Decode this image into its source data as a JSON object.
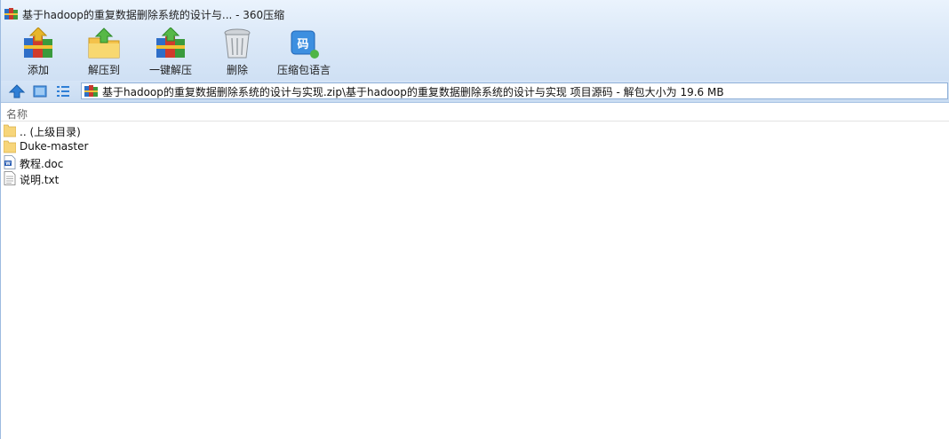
{
  "window": {
    "title": "基于hadoop的重复数据删除系统的设计与... - 360压缩",
    "app_icon": "archive-books-icon"
  },
  "toolbar": {
    "add_label": "添加",
    "extract_to_label": "解压到",
    "one_click_extract_label": "一键解压",
    "delete_label": "删除",
    "language_label": "压缩包语言"
  },
  "address": {
    "path": "基于hadoop的重复数据删除系统的设计与实现.zip\\基于hadoop的重复数据删除系统的设计与实现 项目源码 - 解包大小为 19.6 MB"
  },
  "list": {
    "column_name": "名称",
    "items": [
      {
        "name": ".. (上级目录)",
        "icon": "folder-icon"
      },
      {
        "name": "Duke-master",
        "icon": "folder-icon"
      },
      {
        "name": "教程.doc",
        "icon": "word-doc-icon"
      },
      {
        "name": "说明.txt",
        "icon": "text-file-icon"
      }
    ]
  },
  "colors": {
    "chrome_top": "#eaf3fd",
    "chrome_bottom": "#cfe0f4",
    "folder": "#f7d57a",
    "accent_blue": "#2f7fd6"
  }
}
